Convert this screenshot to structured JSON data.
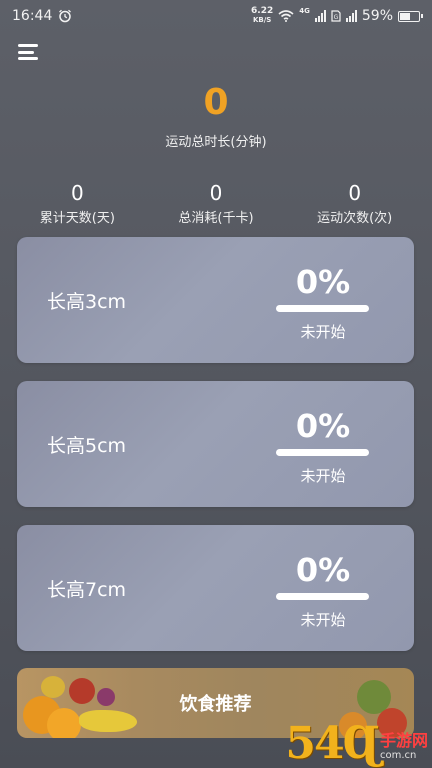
{
  "status_bar": {
    "time": "16:44",
    "net_speed_value": "6.22",
    "net_speed_unit": "KB/S",
    "network_type": "4G",
    "battery": "59%",
    "battery_level": 0.59
  },
  "summary": {
    "total_value": "0",
    "total_label": "运动总时长(分钟)",
    "stats": [
      {
        "value": "0",
        "label": "累计天数(天)"
      },
      {
        "value": "0",
        "label": "总消耗(千卡)"
      },
      {
        "value": "0",
        "label": "运动次数(次)"
      }
    ]
  },
  "goals": [
    {
      "title": "长高3cm",
      "percent": "0%",
      "progress": 0,
      "status": "未开始"
    },
    {
      "title": "长高5cm",
      "percent": "0%",
      "progress": 0,
      "status": "未开始"
    },
    {
      "title": "长高7cm",
      "percent": "0%",
      "progress": 0,
      "status": "未开始"
    }
  ],
  "diet_banner": {
    "label": "饮食推荐"
  },
  "watermark": {
    "logo": "54Ɋ",
    "site_name": "手游网",
    "url": "com.cn"
  },
  "colors": {
    "accent": "#f0a224",
    "background": "#55585f",
    "card": "#9298ae"
  }
}
